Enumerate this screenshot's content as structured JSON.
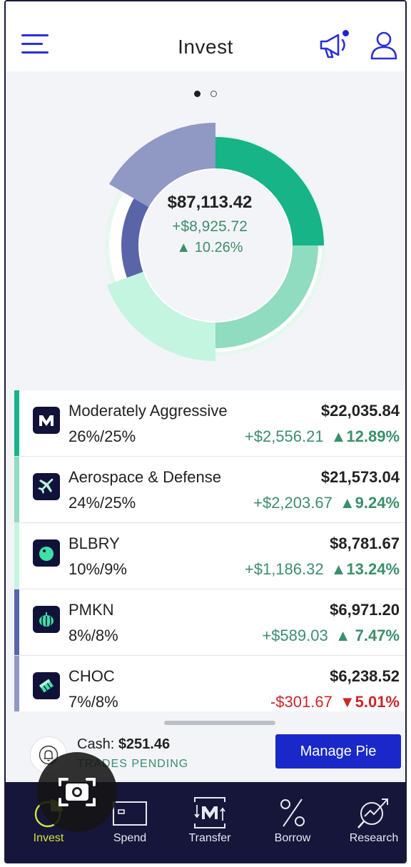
{
  "header": {
    "title": "Invest",
    "menu_icon": "hamburger-menu-icon",
    "announcement_icon": "megaphone-icon",
    "profile_icon": "user-icon"
  },
  "pager": {
    "pages": 2,
    "active_page": 1
  },
  "portfolio": {
    "total": "$87,113.42",
    "gain": "+$8,925.72",
    "gain_pct": "▲ 10.26%"
  },
  "holdings": [
    {
      "name": "Moderately Aggressive",
      "alloc": "26%/25%",
      "value": "$22,035.84",
      "change": "+$2,556.21",
      "change_pct": "▲12.89%",
      "direction": "up",
      "color": "#16b487",
      "icon": "m-logo-icon"
    },
    {
      "name": "Aerospace & Defense",
      "alloc": "24%/25%",
      "value": "$21,573.04",
      "change": "+$2,203.67",
      "change_pct": "▲9.24%",
      "direction": "up",
      "color": "#8fdcc0",
      "icon": "airplane-icon"
    },
    {
      "name": "BLBRY",
      "alloc": "10%/9%",
      "value": "$8,781.67",
      "change": "+$1,186.32",
      "change_pct": "▲13.24%",
      "direction": "up",
      "color": "#c4f5e1",
      "icon": "blueberry-icon"
    },
    {
      "name": "PMKN",
      "alloc": "8%/8%",
      "value": "$6,971.20",
      "change": "+$589.03",
      "change_pct": "▲ 7.47%",
      "direction": "up",
      "color": "#5a64a8",
      "icon": "pumpkin-icon"
    },
    {
      "name": "CHOC",
      "alloc": "7%/8%",
      "value": "$6,238.52",
      "change": "-$301.67",
      "change_pct": "▼5.01%",
      "direction": "down",
      "color": "#9098c4",
      "icon": "chocolate-icon"
    }
  ],
  "cash": {
    "label": "Cash:",
    "amount": "$251.46",
    "status": "TRADES PENDING",
    "bell_icon": "bell-icon"
  },
  "manage_button": "Manage Pie",
  "nav": [
    {
      "label": "Invest",
      "icon": "pie-chart-icon",
      "active": true
    },
    {
      "label": "Spend",
      "icon": "card-icon",
      "active": false
    },
    {
      "label": "Transfer",
      "icon": "transfer-icon",
      "active": false
    },
    {
      "label": "Borrow",
      "icon": "percent-icon",
      "active": false
    },
    {
      "label": "Research",
      "icon": "research-icon",
      "active": false
    }
  ],
  "colors": {
    "brand_blue": "#1a28c9",
    "positive": "#3b8f6c",
    "negative": "#c8282a",
    "nav_bg": "#16163a",
    "active_nav": "#d6e53a"
  }
}
